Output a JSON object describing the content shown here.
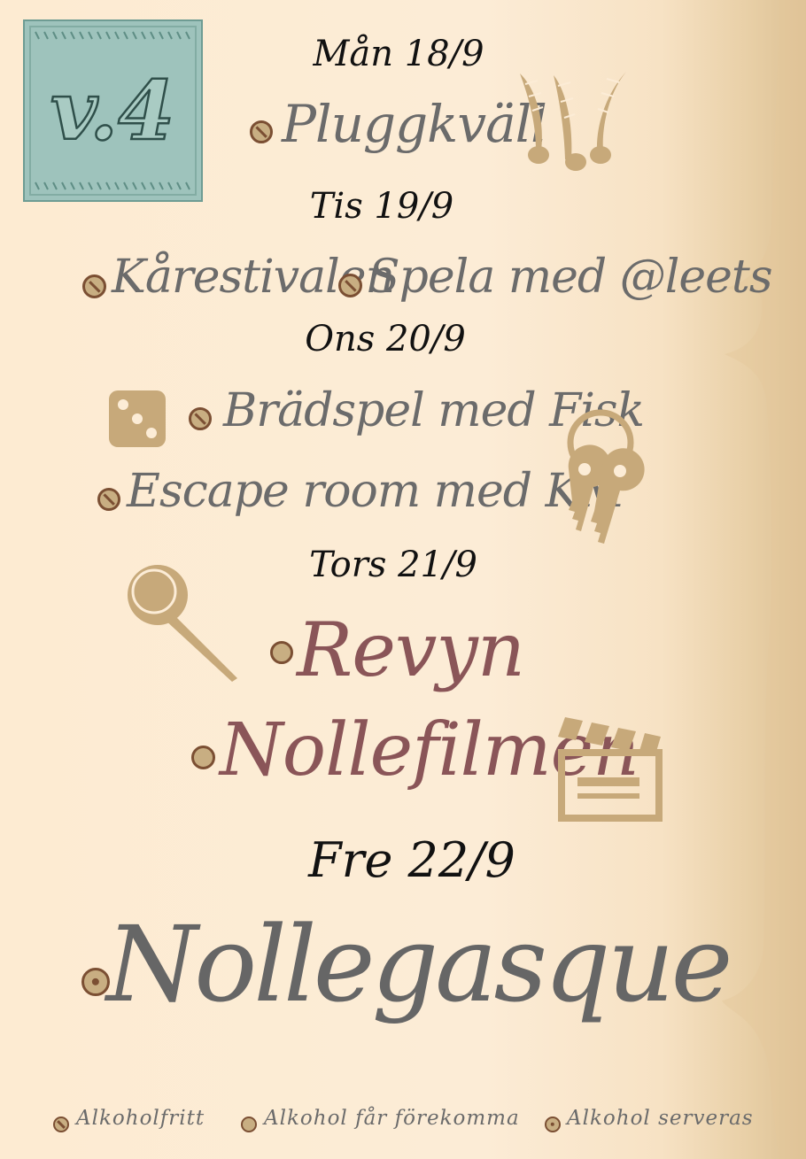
{
  "badge": {
    "text": "v.4"
  },
  "days": [
    {
      "label": "Mån 18/9"
    },
    {
      "label": "Tis 19/9"
    },
    {
      "label": "Ons 20/9"
    },
    {
      "label": "Tors 21/9"
    },
    {
      "label": "Fre 22/9"
    }
  ],
  "events": {
    "pluggkvall": "Pluggkväll",
    "karestivalen": "Kårestivalen",
    "spela": "Spela med @leets",
    "bradspel": "Brädspel med Fisk",
    "escape": "Escape room med KM",
    "revyn": "Revyn",
    "nollefilmen": "Nollefilmen",
    "nollegasque": "Nollegasque"
  },
  "legend": {
    "alkoholfritt": "Alkoholfritt",
    "forekomma": "Alkohol får förekomma",
    "serveras": "Alkohol serveras"
  },
  "colors": {
    "background": "#fcecd6",
    "accent_tan": "#c8ae82",
    "dot_border": "#7b4f33",
    "text_grey": "#6b6b6b",
    "text_red": "#8a5558",
    "badge_teal": "#9ec3bc"
  },
  "icons": [
    "feathers-icon",
    "dice-icon",
    "keys-icon",
    "microphone-icon",
    "clapperboard-icon"
  ]
}
